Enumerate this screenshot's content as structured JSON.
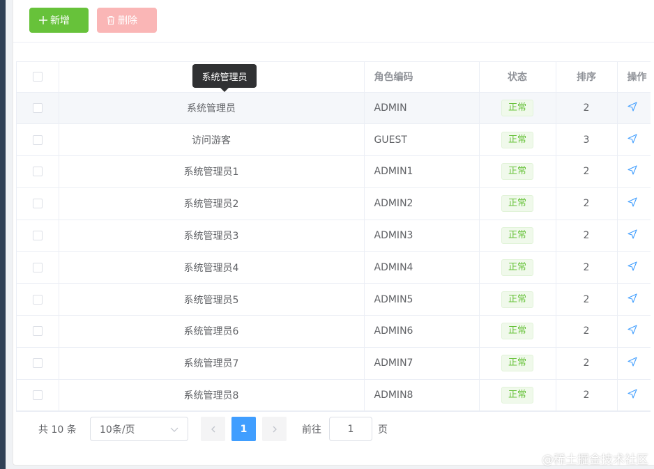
{
  "toolbar": {
    "add_label": "新增",
    "delete_label": "删除"
  },
  "tooltip": {
    "text": "系统管理员"
  },
  "table": {
    "headers": {
      "name": "",
      "code": "角色编码",
      "status": "状态",
      "sort": "排序",
      "op": "操作"
    },
    "rows": [
      {
        "name": "系统管理员",
        "code": "ADMIN",
        "status": "正常",
        "sort": "2"
      },
      {
        "name": "访问游客",
        "code": "GUEST",
        "status": "正常",
        "sort": "3"
      },
      {
        "name": "系统管理员1",
        "code": "ADMIN1",
        "status": "正常",
        "sort": "2"
      },
      {
        "name": "系统管理员2",
        "code": "ADMIN2",
        "status": "正常",
        "sort": "2"
      },
      {
        "name": "系统管理员3",
        "code": "ADMIN3",
        "status": "正常",
        "sort": "2"
      },
      {
        "name": "系统管理员4",
        "code": "ADMIN4",
        "status": "正常",
        "sort": "2"
      },
      {
        "name": "系统管理员5",
        "code": "ADMIN5",
        "status": "正常",
        "sort": "2"
      },
      {
        "name": "系统管理员6",
        "code": "ADMIN6",
        "status": "正常",
        "sort": "2"
      },
      {
        "name": "系统管理员7",
        "code": "ADMIN7",
        "status": "正常",
        "sort": "2"
      },
      {
        "name": "系统管理员8",
        "code": "ADMIN8",
        "status": "正常",
        "sort": "2"
      }
    ]
  },
  "pagination": {
    "total_text": "共 10 条",
    "page_size": "10条/页",
    "current_page": "1",
    "goto_label": "前往",
    "goto_value": "1",
    "page_suffix": "页"
  },
  "watermark": "@稀土掘金技术社区",
  "colors": {
    "primary": "#409eff",
    "success": "#67c23a",
    "danger_disabled": "#fab6b6"
  }
}
